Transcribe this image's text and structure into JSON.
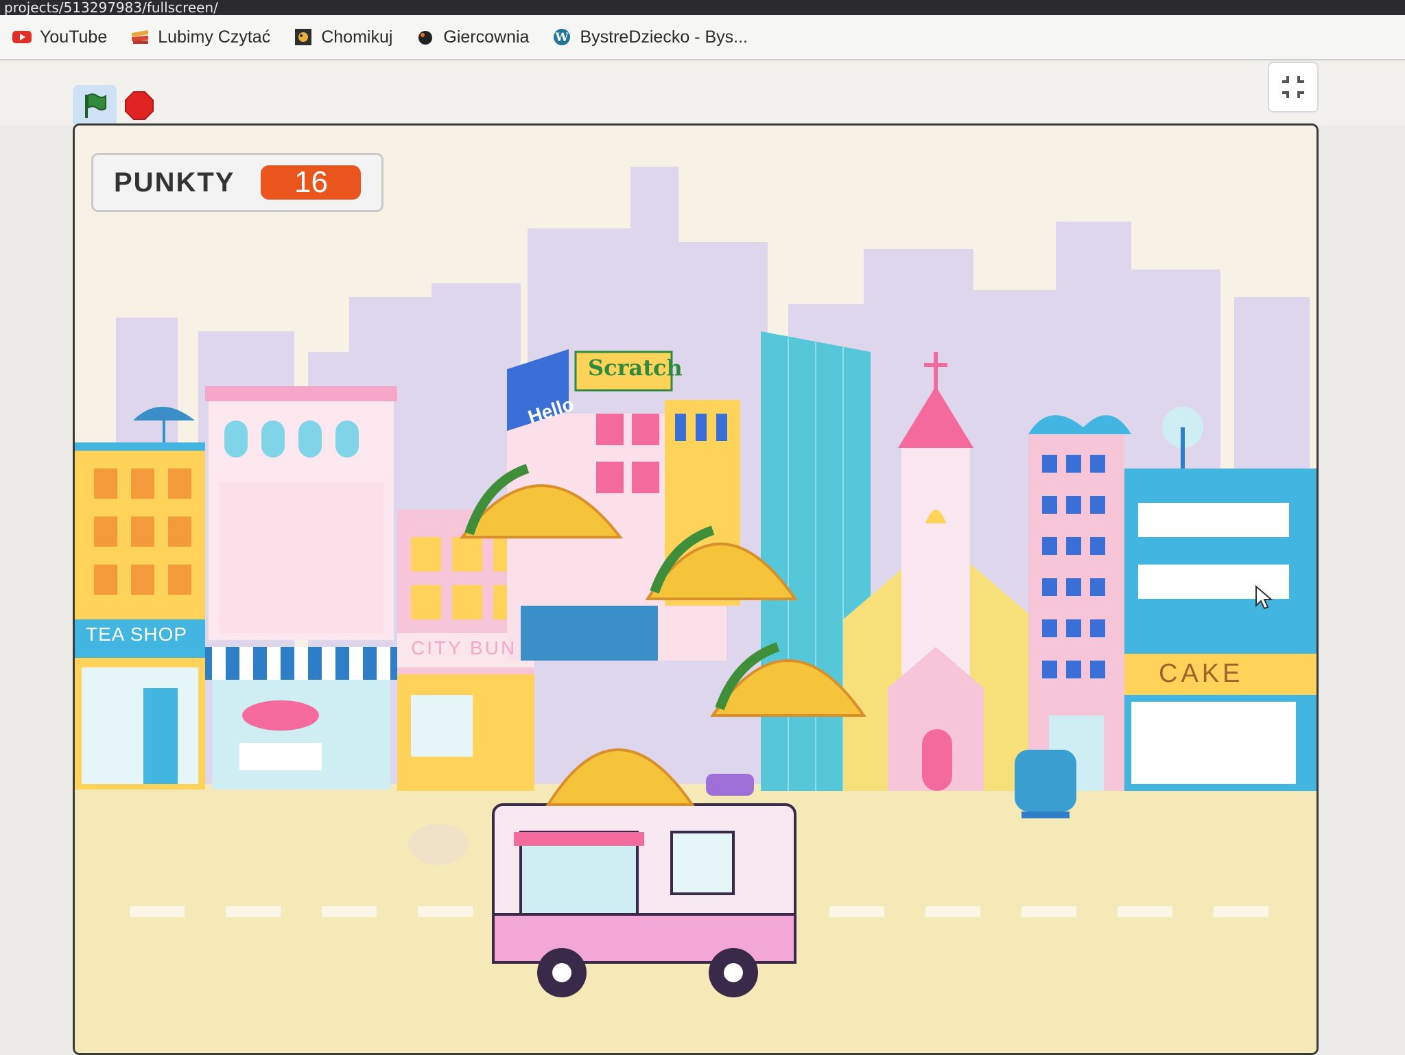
{
  "browser": {
    "url_fragment": "projects/513297983/fullscreen/",
    "bookmarks": [
      {
        "label": "YouTube",
        "icon": "youtube-icon"
      },
      {
        "label": "Lubimy Czytać",
        "icon": "book-stack-icon"
      },
      {
        "label": "Chomikuj",
        "icon": "chomikuj-icon"
      },
      {
        "label": "Giercownia",
        "icon": "giercownia-icon"
      },
      {
        "label": "BystreDziecko - Bys...",
        "icon": "wordpress-icon"
      }
    ]
  },
  "controls": {
    "green_flag": "green-flag-icon",
    "stop": "stop-icon",
    "fullscreen_exit": "exit-fullscreen-icon"
  },
  "stage": {
    "variable_monitor": {
      "label": "PUNKTY",
      "value": "16"
    },
    "scene_signs": {
      "hello": "Hello",
      "scratch": "Scratch",
      "tea_shop": "TEA SHOP",
      "city_bun": "CITY BUN",
      "cake": "CAKE"
    }
  },
  "colors": {
    "monitor_value_bg": "#e9551d",
    "stop_red": "#e02424",
    "flag_green": "#2f8a3b",
    "road": "#f6e9b8"
  }
}
